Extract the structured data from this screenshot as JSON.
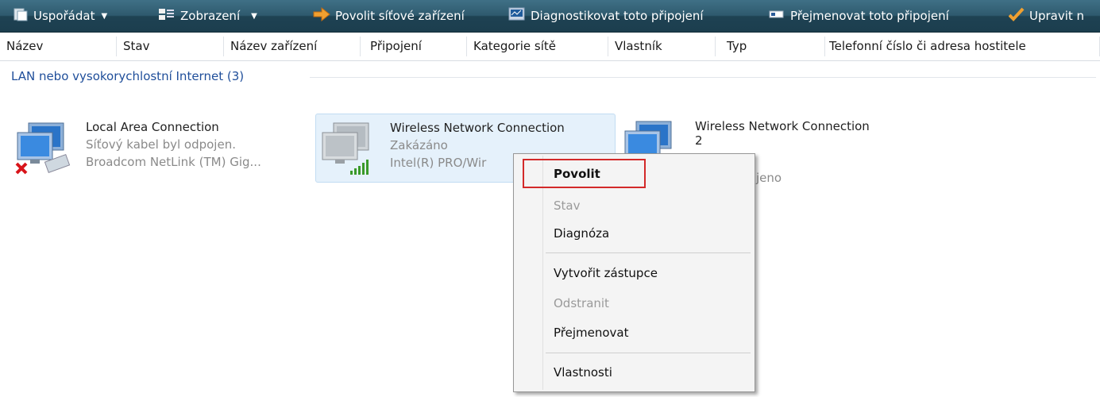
{
  "toolbar": {
    "organize": "Uspořádat",
    "views": "Zobrazení",
    "enable": "Povolit síťové zařízení",
    "diagnose": "Diagnostikovat toto připojení",
    "rename": "Přejmenovat toto připojení",
    "change": "Upravit n"
  },
  "columns": [
    "Název",
    "Stav",
    "Název zařízení",
    "Připojení",
    "Kategorie sítě",
    "Vlastník",
    "Typ",
    "Telefonní číslo či adresa hostitele"
  ],
  "group": {
    "label": "LAN nebo vysokorychlostní Internet (3)"
  },
  "items": [
    {
      "name": "Local Area Connection",
      "status": "Síťový kabel byl odpojen.",
      "device": "Broadcom NetLink (TM) Gig..."
    },
    {
      "name": "Wireless Network Connection",
      "status": "Zakázáno",
      "device": "Intel(R) PRO/Wir"
    },
    {
      "name": "Wireless Network Connection",
      "name2": "2",
      "status_tail": "jeno"
    }
  ],
  "menu": {
    "enable": "Povolit",
    "status": "Stav",
    "diagnose": "Diagnóza",
    "shortcut": "Vytvořit zástupce",
    "delete": "Odstranit",
    "rename": "Přejmenovat",
    "properties": "Vlastnosti"
  },
  "colors": {
    "toolbar": "#2f5a6e",
    "group_text": "#1f4e9a",
    "highlight_border": "#d32a2a",
    "selection": "#e5f1fb"
  },
  "icons": [
    "organize-icon",
    "views-icon",
    "arrow-right-icon",
    "diagnose-icon",
    "rename-icon",
    "checkmark-icon",
    "computer-icon",
    "disconnected-x-icon",
    "signal-bars-icon"
  ]
}
